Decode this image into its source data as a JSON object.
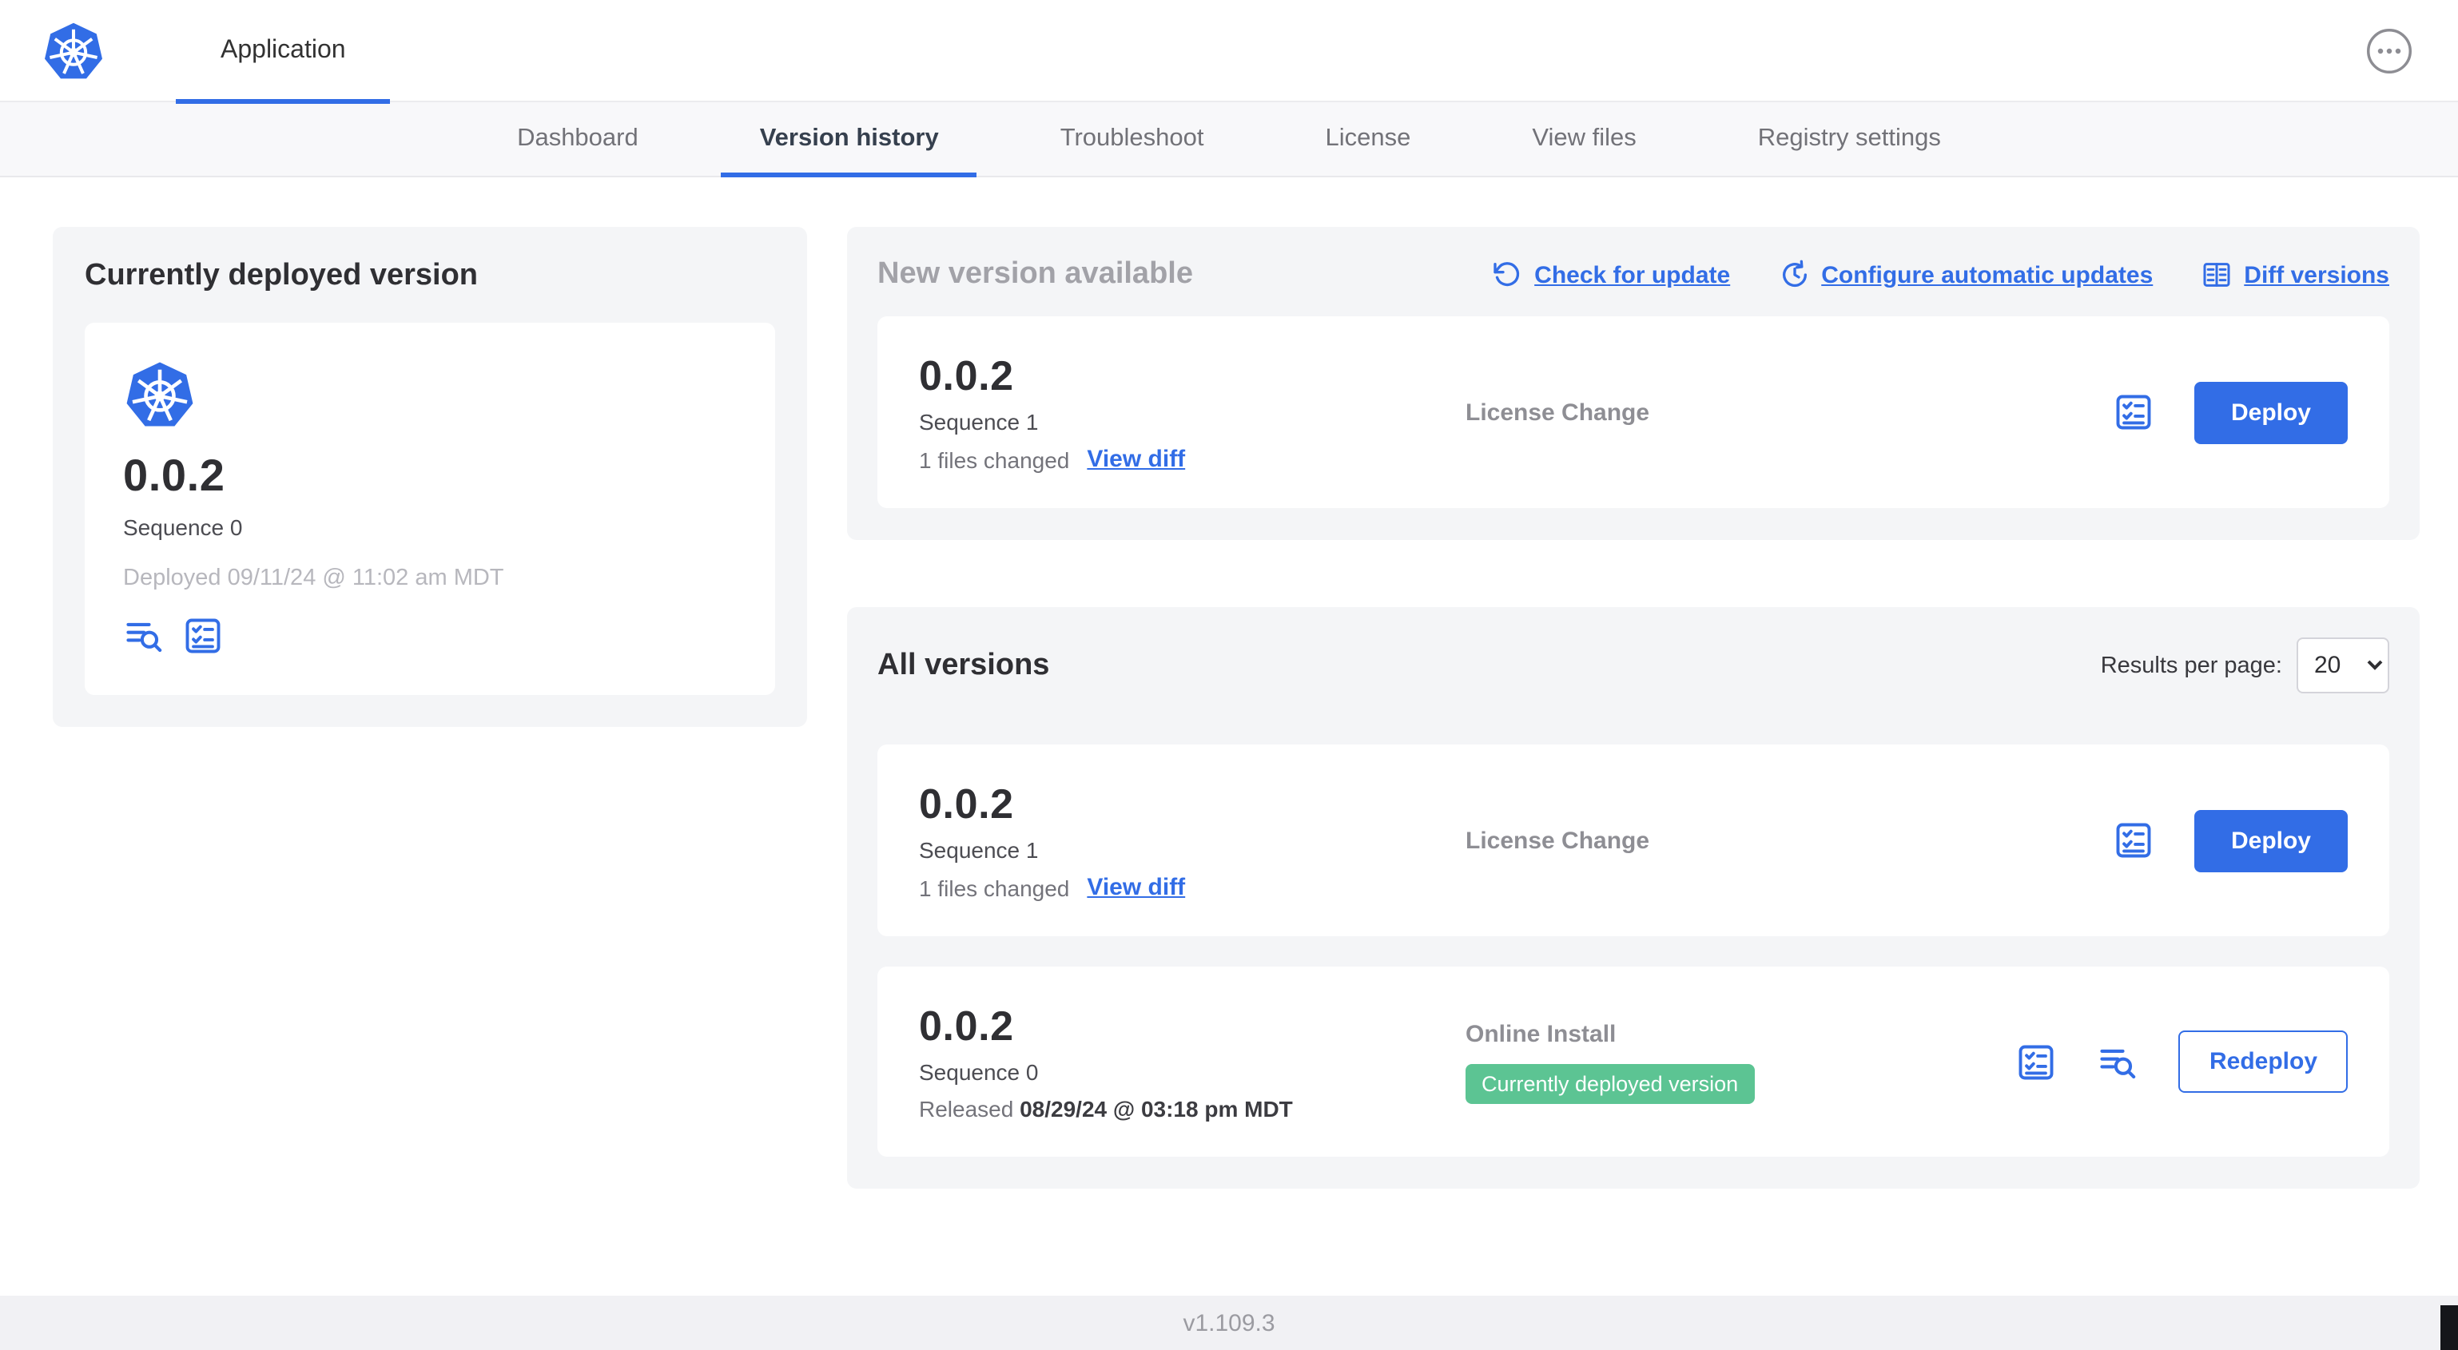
{
  "colors": {
    "accent": "#326de6",
    "badge_green": "#5cc493",
    "nav_bg": "#f8f8fa",
    "card_bg": "#f4f5f7"
  },
  "icons": {
    "logo": "kubernetes-logo",
    "menu": "ellipsis-icon",
    "check_update": "rotate-ccw-icon",
    "auto_update": "clock-refresh-icon",
    "diff": "diff-columns-icon",
    "checklist": "checklist-icon",
    "logs": "logs-search-icon"
  },
  "header": {
    "app_tab": "Application"
  },
  "nav": {
    "tabs": [
      {
        "label": "Dashboard"
      },
      {
        "label": "Version history"
      },
      {
        "label": "Troubleshoot"
      },
      {
        "label": "License"
      },
      {
        "label": "View files"
      },
      {
        "label": "Registry settings"
      }
    ],
    "active_tab": "Version history"
  },
  "current": {
    "title": "Currently deployed version",
    "version": "0.0.2",
    "sequence": "Sequence 0",
    "deployed": "Deployed 09/11/24 @ 11:02 am MDT"
  },
  "new_version": {
    "title": "New version available",
    "actions": {
      "check_for_update": "Check for update",
      "configure_auto_updates": "Configure automatic updates",
      "diff_versions": "Diff versions"
    },
    "row": {
      "version": "0.0.2",
      "sequence": "Sequence 1",
      "files_changed": "1 files changed",
      "view_diff": "View diff",
      "type": "License Change",
      "deploy_label": "Deploy"
    }
  },
  "all_versions": {
    "title": "All versions",
    "results_per_page_label": "Results per page:",
    "per_page_value": "20",
    "rows": [
      {
        "version": "0.0.2",
        "sequence": "Sequence 1",
        "files_changed": "1 files changed",
        "view_diff": "View diff",
        "type": "License Change",
        "action_label": "Deploy"
      },
      {
        "version": "0.0.2",
        "sequence": "Sequence 0",
        "released_label": "Released",
        "released_date": "08/29/24 @ 03:18 pm MDT",
        "type": "Online Install",
        "badge": "Currently deployed version",
        "action_label": "Redeploy"
      }
    ]
  },
  "footer": {
    "app_version": "v1.109.3"
  }
}
